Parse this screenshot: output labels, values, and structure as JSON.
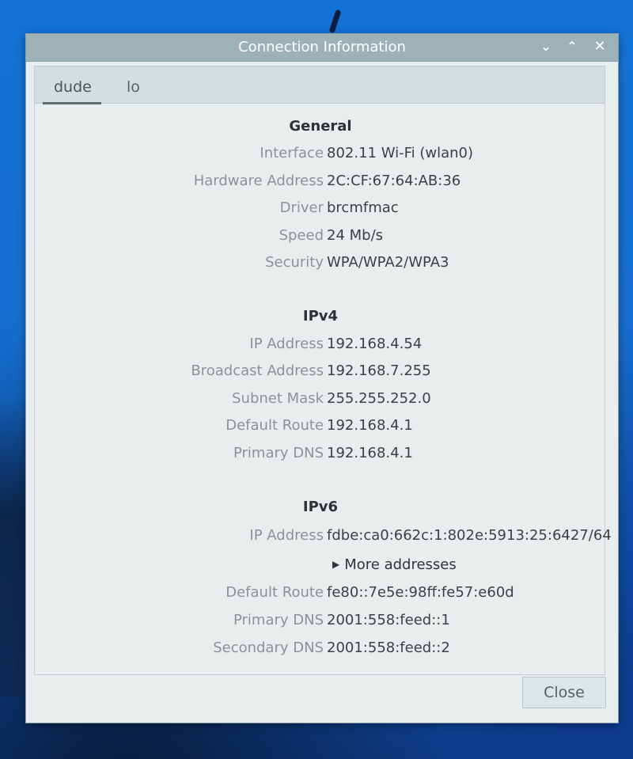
{
  "window": {
    "title": "Connection Information",
    "controls": {
      "minimize": "⌄",
      "maximize": "⌃",
      "close": "✕"
    }
  },
  "tabs": [
    {
      "label": "dude",
      "active": true
    },
    {
      "label": "lo",
      "active": false
    }
  ],
  "general": {
    "title": "General",
    "rows": [
      {
        "label": "Interface",
        "value": "802.11 Wi-Fi (wlan0)"
      },
      {
        "label": "Hardware Address",
        "value": "2C:CF:67:64:AB:36"
      },
      {
        "label": "Driver",
        "value": "brcmfmac"
      },
      {
        "label": "Speed",
        "value": "24 Mb/s"
      },
      {
        "label": "Security",
        "value": "WPA/WPA2/WPA3"
      }
    ]
  },
  "ipv4": {
    "title": "IPv4",
    "rows": [
      {
        "label": "IP Address",
        "value": "192.168.4.54"
      },
      {
        "label": "Broadcast Address",
        "value": "192.168.7.255"
      },
      {
        "label": "Subnet Mask",
        "value": "255.255.252.0"
      },
      {
        "label": "Default Route",
        "value": "192.168.4.1"
      },
      {
        "label": "Primary DNS",
        "value": "192.168.4.1"
      }
    ]
  },
  "ipv6": {
    "title": "IPv6",
    "ip_address": {
      "label": "IP Address",
      "value": "fdbe:ca0:662c:1:802e:5913:25:6427/64"
    },
    "more_addresses": "More addresses",
    "rows": [
      {
        "label": "Default Route",
        "value": "fe80::7e5e:98ff:fe57:e60d"
      },
      {
        "label": "Primary DNS",
        "value": "2001:558:feed::1"
      },
      {
        "label": "Secondary DNS",
        "value": "2001:558:feed::2"
      }
    ]
  },
  "buttons": {
    "close": "Close"
  },
  "colors": {
    "titlebar": "#9db2b7",
    "window_bg": "#e7eeed",
    "label_text": "#8a9297",
    "value_text": "#3a4146"
  }
}
